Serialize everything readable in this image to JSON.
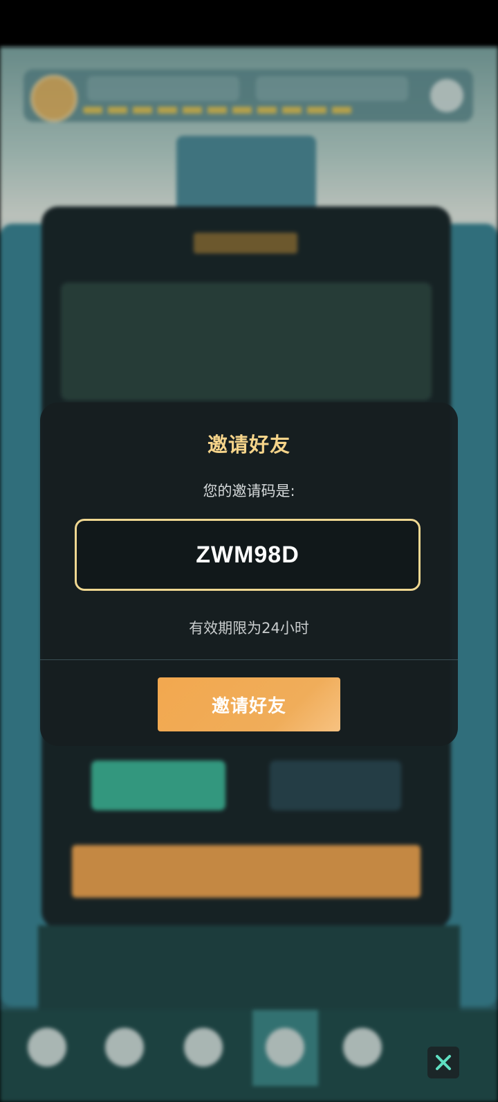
{
  "modal": {
    "title": "邀请好友",
    "subtitle": "您的邀请码是:",
    "invite_code": "ZWM98D",
    "validity": "有效期限为24小时",
    "button_label": "邀请好友"
  },
  "colors": {
    "title": "#f6d48a",
    "code_border": "#efd791",
    "button": "#f2a84f"
  },
  "icons": {
    "close": "close-icon",
    "settings": "gear-icon",
    "nav": [
      "warning-icon",
      "bag-icon",
      "compass-icon",
      "diamond-icon",
      "heart-diamond-icon"
    ]
  }
}
